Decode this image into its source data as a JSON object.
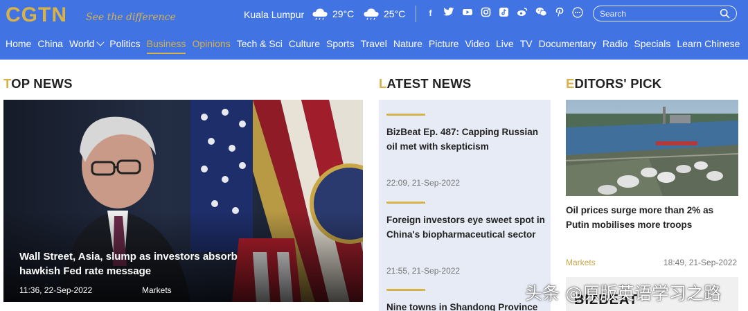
{
  "header": {
    "logo": "CGTN",
    "tagline": "See the difference",
    "city": "Kuala Lumpur",
    "weather": [
      {
        "icon": "rain-cloud-icon",
        "temp": "29°C"
      },
      {
        "icon": "rain-cloud-icon",
        "temp": "25°C"
      }
    ],
    "social": [
      "facebook-icon",
      "twitter-icon",
      "youtube-icon",
      "instagram-icon",
      "tiktok-icon",
      "weibo-icon",
      "wechat-icon",
      "pinterest-icon",
      "more-icon"
    ],
    "search_placeholder": "Search",
    "colors": {
      "bar": "#4273e2",
      "accent": "#d6b24a"
    }
  },
  "nav": {
    "items": [
      "Home",
      "China",
      "World",
      "Politics",
      "Business",
      "Opinions",
      "Tech & Sci",
      "Culture",
      "Sports",
      "Travel",
      "Nature",
      "Picture",
      "Video",
      "Live",
      "TV",
      "Documentary",
      "Radio",
      "Specials",
      "Learn Chinese"
    ],
    "active": "Business"
  },
  "top_news": {
    "title_first": "T",
    "title_rest": "OP NEWS",
    "headline": "Wall Street, Asia, slump as investors absorb hawkish Fed rate message",
    "time": "11:36, 22-Sep-2022",
    "category": "Markets"
  },
  "latest_news": {
    "title_first": "L",
    "title_rest": "ATEST NEWS",
    "items": [
      {
        "headline": "BizBeat Ep. 487: Capping Russian oil met with skepticism",
        "time": "22:09, 21-Sep-2022"
      },
      {
        "headline": "Foreign investors eye sweet spot in China's biopharmaceutical sector",
        "time": "21:55, 21-Sep-2022"
      },
      {
        "headline": "Nine towns in Shandong Province",
        "time": ""
      }
    ]
  },
  "editors_pick": {
    "title_first": "E",
    "title_rest": "DITORS' PICK",
    "headline": "Oil prices surge more than 2% as Putin mobilises more troops",
    "category": "Markets",
    "time": "18:49, 21-Sep-2022",
    "banner": "BIZBEAT"
  },
  "watermark": "头条 @原版英语学习之路"
}
